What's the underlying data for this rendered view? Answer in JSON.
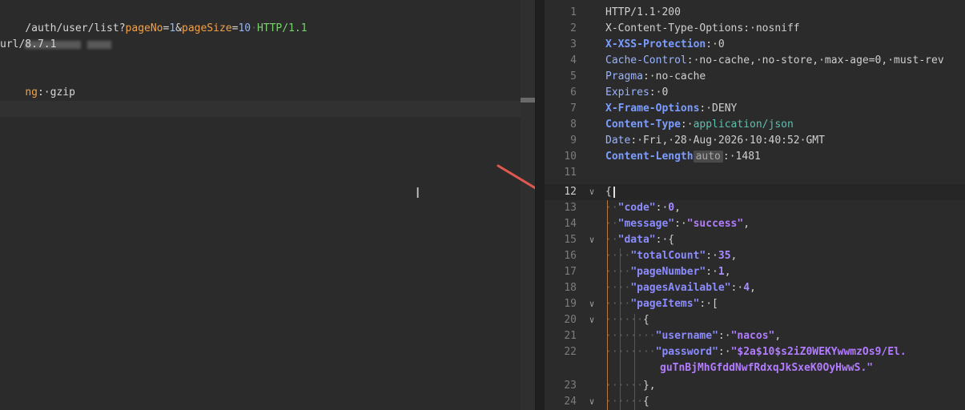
{
  "request": {
    "line1": {
      "path": "/auth/user/list?",
      "p1": "pageNo",
      "eq1": "=",
      "v1": "1",
      "amp": "&",
      "p2": "pageSize",
      "eq2": "=",
      "v2": "10",
      "sp": "·",
      "proto": "HTTP/1.1"
    },
    "line3": "url/8.7.1",
    "line5_key": "ng",
    "line5_rest": ":·gzip"
  },
  "response": {
    "line_numbers": [
      "1",
      "2",
      "3",
      "4",
      "5",
      "6",
      "7",
      "8",
      "9",
      "10",
      "11",
      "12",
      "13",
      "14",
      "15",
      "16",
      "17",
      "18",
      "19",
      "20",
      "21",
      "22",
      "",
      "23",
      "24"
    ],
    "headers": [
      {
        "name": "HTTP/1.1·200",
        "value": "",
        "style": "plain"
      },
      {
        "name": "X-Content-Type-Options",
        "value": ":·nosniff",
        "style": "plain"
      },
      {
        "name": "X-XSS-Protection",
        "value": ":·0",
        "style": "bold"
      },
      {
        "name": "Cache-Control",
        "value": ":·no-cache,·no-store,·max-age=0,·must-rev",
        "style": "plain"
      },
      {
        "name": "Pragma",
        "value": ":·no-cache",
        "style": "plain"
      },
      {
        "name": "Expires",
        "value": ":·0",
        "style": "plain"
      },
      {
        "name": "X-Frame-Options",
        "value": ":·DENY",
        "style": "bold"
      },
      {
        "name": "Content-Type",
        "value": "application/json",
        "style": "bold"
      },
      {
        "name": "Date",
        "value": ":·Fri,·28·Aug·2026·10:40:52·GMT",
        "style": "plain"
      },
      {
        "name": "Content-Length",
        "value": ":·1481",
        "style": "bold"
      }
    ],
    "content_length_badge": "auto",
    "json": {
      "open": "{",
      "code_key": "\"code\"",
      "code_val": "0",
      "message_key": "\"message\"",
      "message_val": "\"success\"",
      "data_key": "\"data\"",
      "total_key": "\"totalCount\"",
      "total_val": "35",
      "pagenum_key": "\"pageNumber\"",
      "pagenum_val": "1",
      "pages_key": "\"pagesAvailable\"",
      "pages_val": "4",
      "items_key": "\"pageItems\"",
      "username_key": "\"username\"",
      "username_val": "\"nacos\"",
      "password_key": "\"password\"",
      "password_val_1": "\"$2a$10$s2iZ0WEKYwwmzOs9/El.",
      "password_val_2": "guTnBjMhGfddNwfRdxqJkSxeK0OyHwwS.\"",
      "close_obj": "},",
      "open_obj": "{"
    }
  },
  "colors": {
    "background": "#2b2b2b",
    "arrow": "#e0584f",
    "header_name": "#7c9dff",
    "json_string": "#b27cff"
  }
}
